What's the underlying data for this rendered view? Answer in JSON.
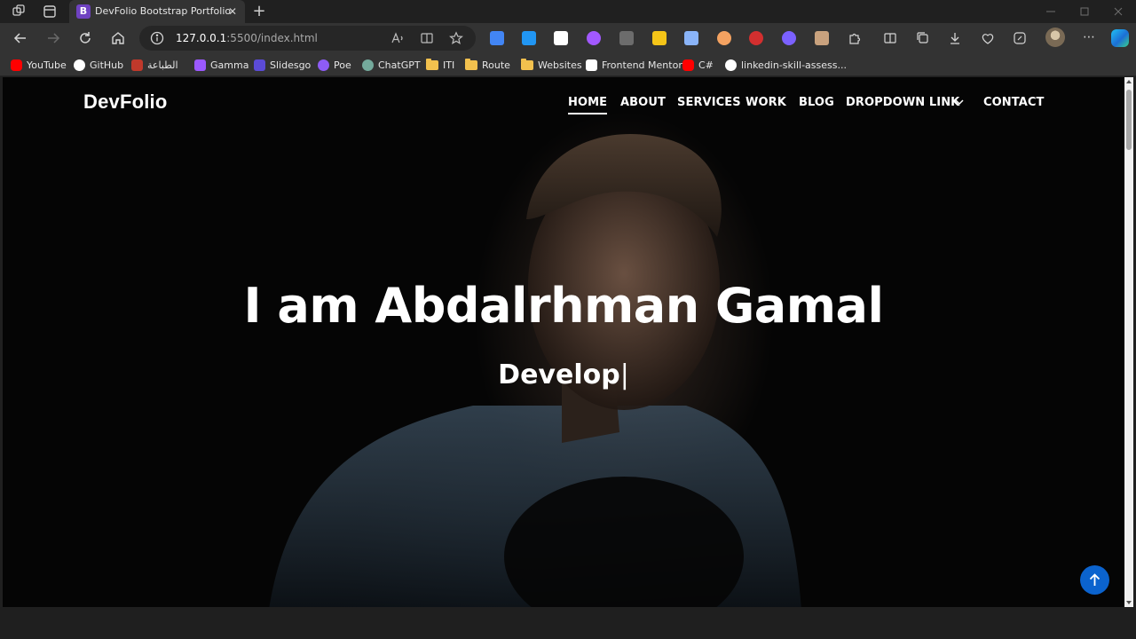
{
  "window": {
    "tab_title": "DevFolio Bootstrap Portfolio",
    "tab_favicon_letter": "B"
  },
  "toolbar": {
    "url_host": "127.0.0.1",
    "url_path": ":5500/index.html"
  },
  "bookmarks": [
    {
      "label": "YouTube",
      "icon": "youtube-icon",
      "color": "#ff0000"
    },
    {
      "label": "GitHub",
      "icon": "github-icon",
      "color": "#ffffff"
    },
    {
      "label": "الطباعة",
      "icon": "print-site-icon",
      "color": "#c0392b"
    },
    {
      "label": "Gamma",
      "icon": "gamma-icon",
      "color": "#9b59ff"
    },
    {
      "label": "Slidesgo",
      "icon": "slidesgo-icon",
      "color": "#5b4bd6"
    },
    {
      "label": "Poe",
      "icon": "poe-icon",
      "color": "#8e5cf6"
    },
    {
      "label": "ChatGPT",
      "icon": "chatgpt-icon",
      "color": "#74aa9c"
    },
    {
      "label": "ITI",
      "icon": "folder-icon",
      "color": "#f2c14e"
    },
    {
      "label": "Route",
      "icon": "folder-icon",
      "color": "#f2c14e"
    },
    {
      "label": "Websites",
      "icon": "folder-icon",
      "color": "#f2c14e"
    },
    {
      "label": "Frontend Mentor",
      "icon": "frontend-mentor-icon",
      "color": "#ffffff"
    },
    {
      "label": "C#",
      "icon": "youtube-icon",
      "color": "#ff0000"
    },
    {
      "label": "linkedin-skill-assess...",
      "icon": "github-icon",
      "color": "#ffffff"
    }
  ],
  "site": {
    "brand": "DevFolio",
    "nav": [
      "HOME",
      "ABOUT",
      "SERVICES",
      "WORK",
      "BLOG",
      "DROPDOWN LINK",
      "CONTACT"
    ],
    "active_nav": "HOME",
    "hero_title": "I am Abdalrhman Gamal",
    "hero_subtitle": "Develop",
    "cursor": "|"
  },
  "colors": {
    "accent": "#0b63ce",
    "nav_text": "#ffffff",
    "page_bg": "#000000"
  }
}
